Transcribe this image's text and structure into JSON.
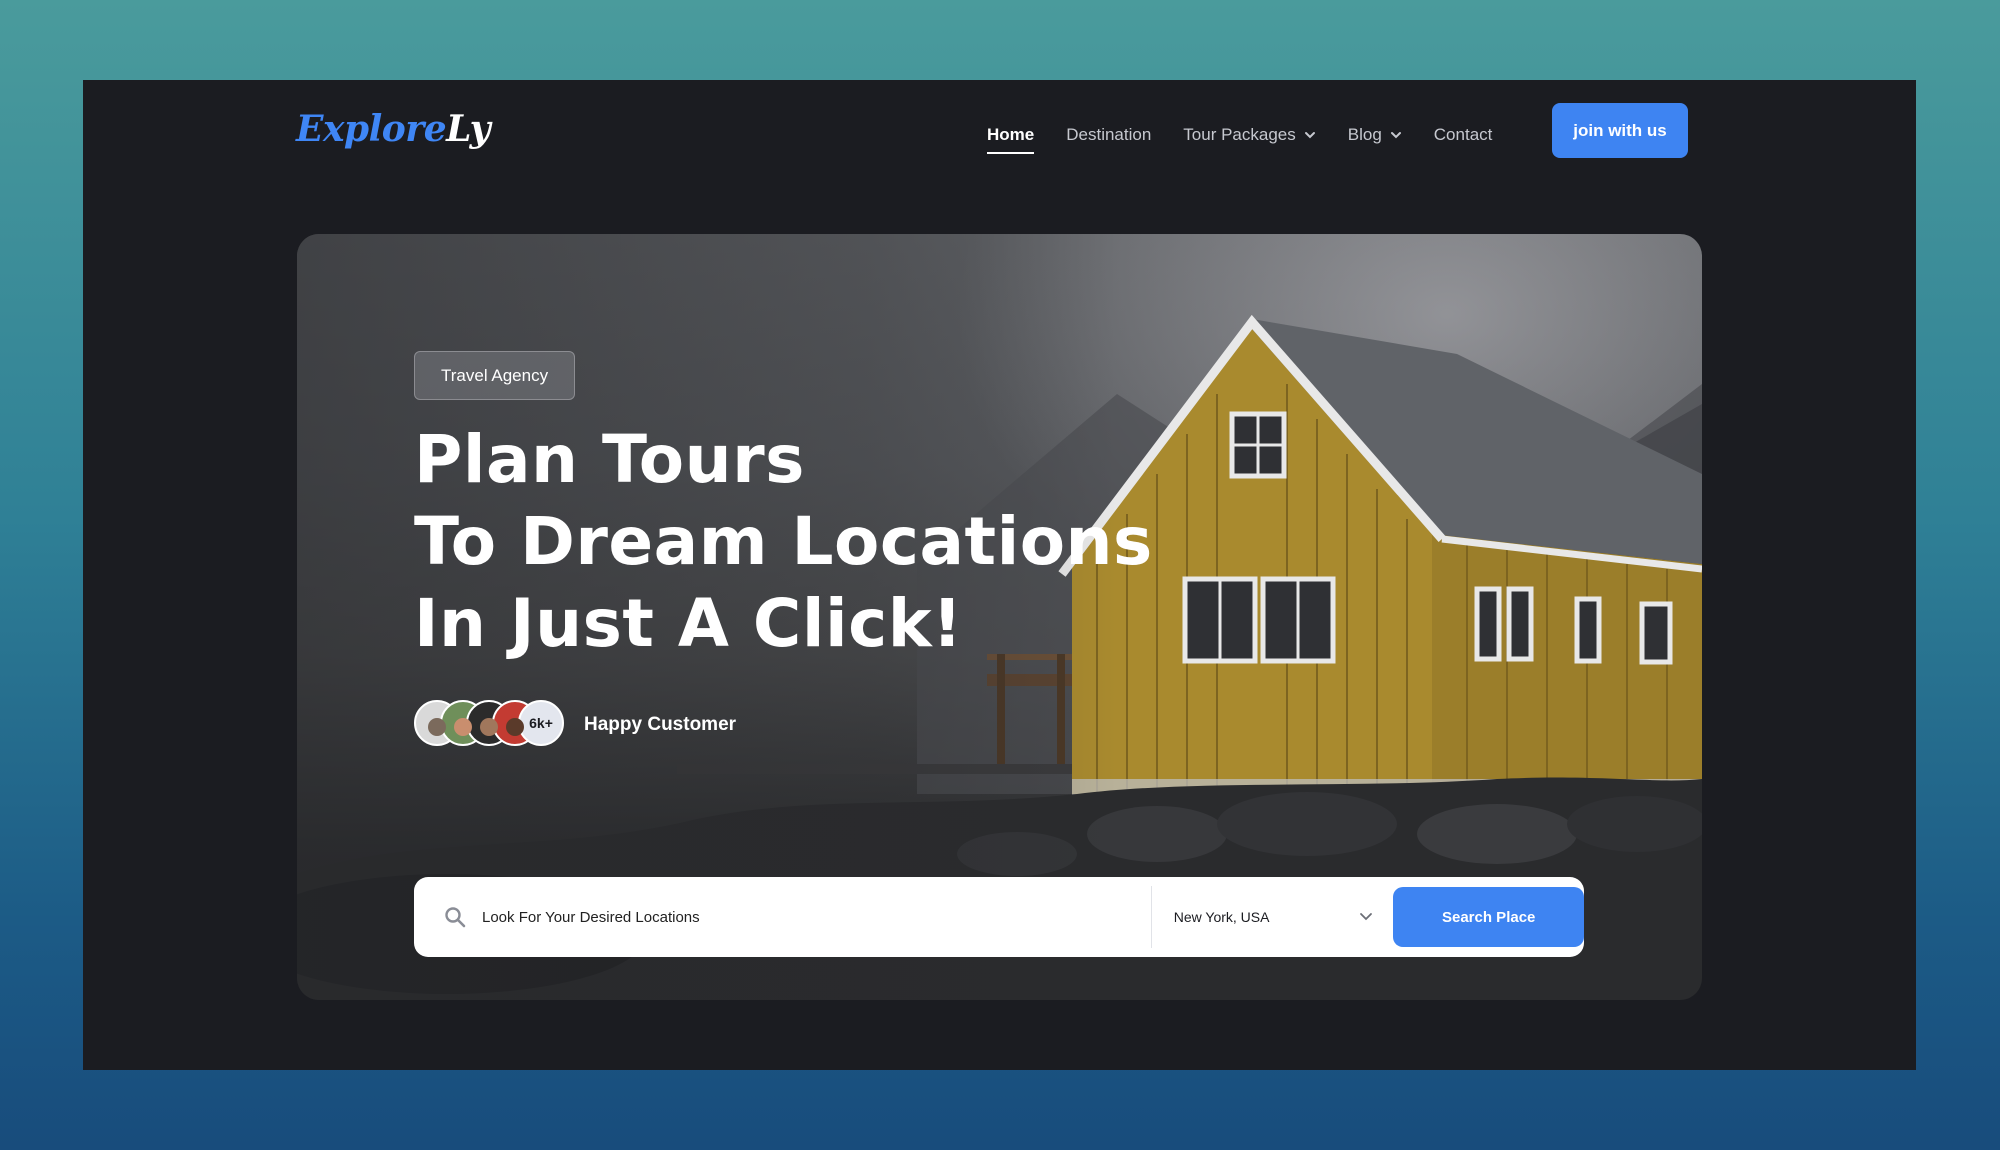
{
  "header": {
    "logo": {
      "part1": "Explore",
      "part2": "Ly"
    },
    "nav": [
      {
        "label": "Home",
        "active": true,
        "dropdown": false
      },
      {
        "label": "Destination",
        "active": false,
        "dropdown": false
      },
      {
        "label": "Tour Packages",
        "active": false,
        "dropdown": true
      },
      {
        "label": "Blog",
        "active": false,
        "dropdown": true
      },
      {
        "label": "Contact",
        "active": false,
        "dropdown": false
      }
    ],
    "cta_label": "join with us"
  },
  "hero": {
    "tag": "Travel Agency",
    "headline": [
      "Plan Tours",
      "To Dream Locations",
      "In Just A Click!"
    ],
    "customers": {
      "count_badge": "6k+",
      "label": "Happy Customer"
    }
  },
  "search": {
    "placeholder": "Look For Your Desired Locations",
    "location": "New York, USA",
    "button_label": "Search Place"
  },
  "colors": {
    "accent": "#3e84f2",
    "frame_bg": "#1b1c21",
    "logo_blue": "#3f86f5"
  },
  "icons": [
    "search-icon",
    "chevron-down-icon"
  ]
}
